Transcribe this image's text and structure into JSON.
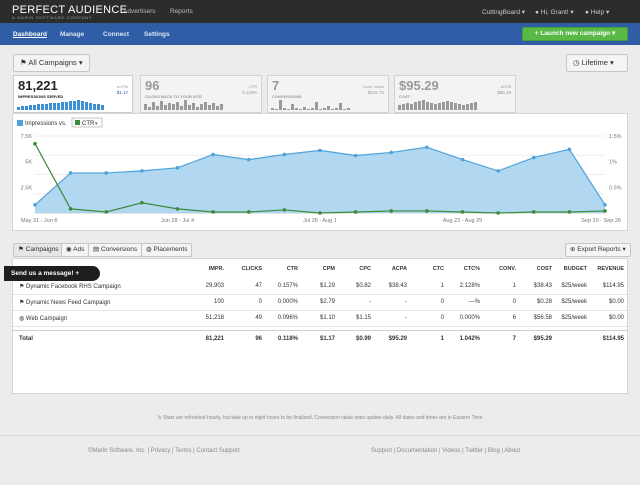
{
  "brand": {
    "name": "PERFECT AUDIENCE",
    "tagline": "A MARIN SOFTWARE COMPANY"
  },
  "top_nav": [
    "Advertisers",
    "Reports"
  ],
  "top_right": {
    "account": "CuttingBoard",
    "user": "Hi, Grant!",
    "help": "Help"
  },
  "sub_nav": [
    "Dashboard",
    "Manage",
    "Connect",
    "Settings"
  ],
  "launch_label": "Launch new campaign",
  "filter": {
    "campaigns": "All Campaigns",
    "period": "Lifetime"
  },
  "tiles": [
    {
      "value": "81,221",
      "label": "IMPRESSIONS SERVED",
      "sub_label": "eCPM",
      "sub_value": "$1.17",
      "spark": [
        0.3,
        0.4,
        0.45,
        0.5,
        0.55,
        0.6,
        0.6,
        0.65,
        0.7,
        0.7,
        0.75,
        0.8,
        0.85,
        0.9,
        0.95,
        1.0,
        0.9,
        0.8,
        0.7,
        0.65,
        0.6,
        0.55
      ]
    },
    {
      "value": "96",
      "label": "CLICKS BACK TO YOUR SITE",
      "sub_label": "CTR",
      "sub_value": "0.118%",
      "spark": [
        0.6,
        0.3,
        0.8,
        0.4,
        0.9,
        0.5,
        0.7,
        0.6,
        0.8,
        0.4,
        1.0,
        0.5,
        0.7,
        0.3,
        0.6,
        0.8,
        0.5,
        0.7,
        0.4,
        0.6
      ]
    },
    {
      "value": "7",
      "label": "CONVERSIONS",
      "sub_label": "Conv. Value",
      "sub_value": "$615.70",
      "spark": [
        0.2,
        0.1,
        1.0,
        0.2,
        0.1,
        0.6,
        0.2,
        0.1,
        0.3,
        0.1,
        0.2,
        0.8,
        0.1,
        0.2,
        0.4,
        0.1,
        0.2,
        0.7,
        0.1,
        0.2
      ]
    },
    {
      "value": "$95.29",
      "label": "COST",
      "sub_label": "eCPA",
      "sub_value": "$95.29",
      "spark": [
        0.5,
        0.6,
        0.7,
        0.6,
        0.8,
        0.9,
        1.0,
        0.8,
        0.7,
        0.6,
        0.7,
        0.8,
        0.9,
        0.8,
        0.7,
        0.6,
        0.5,
        0.6,
        0.7,
        0.8
      ]
    }
  ],
  "chart_controls": {
    "series_a": "Impressions vs.",
    "series_b": "CTR"
  },
  "chart_data": {
    "type": "line",
    "x": [
      "May 31 - Jun 6",
      "",
      "",
      "",
      "Jun 28 - Jul 4",
      "",
      "",
      "",
      "Jul 26 - Aug 1",
      "",
      "",
      "",
      "Aug 23 - Aug 29",
      "",
      "",
      "",
      "Sep 20 - Sep 26"
    ],
    "x_tick_labels": [
      "May 31 - Jun 6",
      "Jun 28 - Jul 4",
      "Jul 26 - Aug 1",
      "Aug 23 - Aug 29",
      "Sep 20 - Sep 26"
    ],
    "series": [
      {
        "name": "Impressions",
        "axis": "left",
        "color": "#4fa3dc",
        "values": [
          800,
          3900,
          3900,
          4100,
          4400,
          5700,
          5200,
          5700,
          6100,
          5600,
          5900,
          6400,
          5200,
          4100,
          5400,
          6200,
          800
        ]
      },
      {
        "name": "CTR",
        "axis": "right",
        "color": "#3d8a3d",
        "values": [
          1.35,
          0.08,
          0.02,
          0.2,
          0.08,
          0.02,
          0.02,
          0.06,
          0.0,
          0.02,
          0.04,
          0.04,
          0.02,
          0.0,
          0.02,
          0.02,
          0.04
        ]
      }
    ],
    "ylim_left": [
      0,
      7500
    ],
    "ylim_right": [
      0,
      1.5
    ],
    "left_ticks": [
      "2.5K",
      "5K",
      "7.5K"
    ],
    "right_ticks": [
      "0.5%",
      "1%",
      "1.5%"
    ]
  },
  "table_tabs": [
    "Campaigns",
    "Ads",
    "Conversions",
    "Placements"
  ],
  "export_label": "Export Reports",
  "send_message": "Send us a message!",
  "columns": [
    "IMPR.",
    "CLICKS",
    "CTR",
    "CPM",
    "CPC",
    "ACPA",
    "CTC",
    "CTC%",
    "CONV.",
    "COST",
    "BUDGET",
    "REVENUE"
  ],
  "rows": [
    {
      "name": "Dynamic Facebook RHS Campaign",
      "cells": [
        "29,903",
        "47",
        "0.157%",
        "$1.29",
        "$0.82",
        "$38.43",
        "1",
        "2.128%",
        "1",
        "$38.43",
        "$25/week",
        "$114.95"
      ]
    },
    {
      "name": "Dynamic News Feed Campaign",
      "cells": [
        "100",
        "0",
        "0.000%",
        "$2.79",
        "-",
        "-",
        "0",
        "—%",
        "0",
        "$0.28",
        "$25/week",
        "$0.00"
      ]
    },
    {
      "name": "Web Campaign",
      "cells": [
        "51,218",
        "49",
        "0.096%",
        "$1.10",
        "$1.15",
        "-",
        "0",
        "0.000%",
        "6",
        "$56.58",
        "$25/week",
        "$0.00"
      ]
    }
  ],
  "total": {
    "name": "Total",
    "cells": [
      "81,221",
      "96",
      "0.118%",
      "$1.17",
      "$0.99",
      "$95.29",
      "1",
      "1.042%",
      "7",
      "$95.29",
      "",
      "$114.95"
    ]
  },
  "footnote": "Stats are refreshed hourly, but take up to eight hours to be finalized. Conversion value stats update daily. All dates and times are in Eastern Time",
  "footer_left": [
    "©Marin Software, Inc.",
    "Privacy",
    "Terms",
    "Contact Support"
  ],
  "footer_right": [
    "Support",
    "Documentation",
    "Videos",
    "Twitter",
    "Blog",
    "About"
  ],
  "colors": {
    "topbar": "#2c2c2c",
    "subnav": "#2f5ea6",
    "launch": "#58b947",
    "impressions": "#4fa3dc",
    "ctr": "#3d8a3d"
  }
}
